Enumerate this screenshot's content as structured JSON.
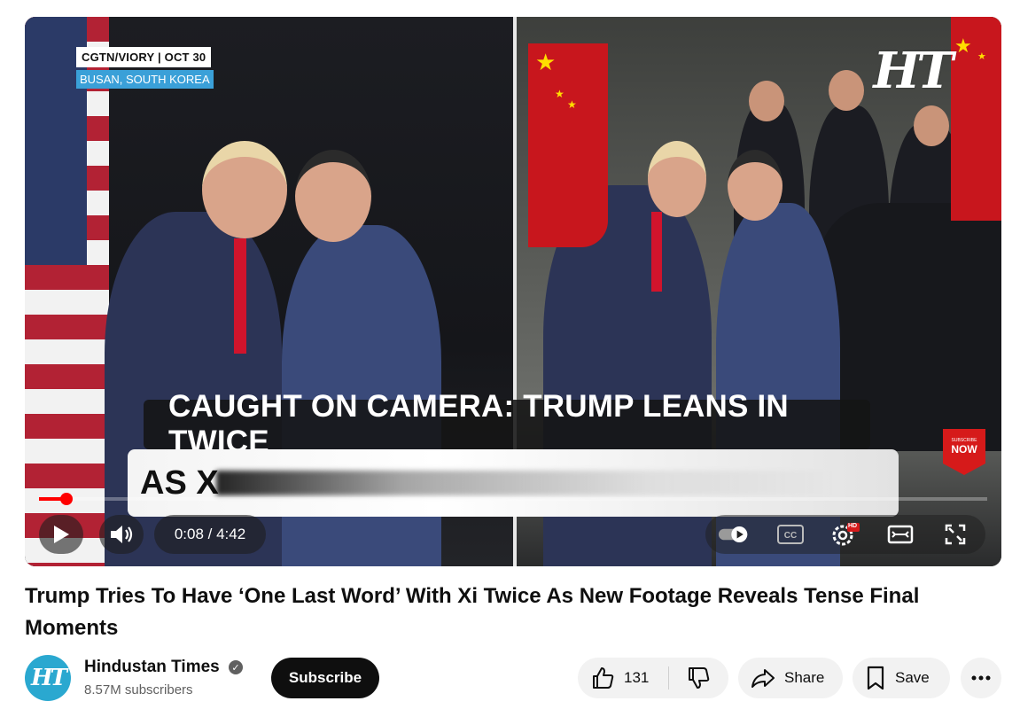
{
  "video": {
    "overlay_source": "CGTN/VIORY | OCT 30",
    "overlay_location": "BUSAN, SOUTH KOREA",
    "watermark": "HT",
    "caption_line1": "CAUGHT ON CAMERA: TRUMP LEANS IN TWICE",
    "caption_line2": "AS X",
    "subscribe_badge_small": "SUBSCRIBE",
    "subscribe_badge_big": "NOW"
  },
  "player": {
    "progress_fraction": 0.029,
    "current_time": "0:08",
    "duration": "4:42",
    "time_display": "0:08 / 4:42",
    "hd_badge": "HD",
    "icons": [
      "play-icon",
      "volume-icon",
      "autoplay-toggle-icon",
      "captions-icon",
      "settings-icon",
      "theater-mode-icon",
      "fullscreen-icon"
    ]
  },
  "title": "Trump Tries To Have ‘One Last Word’ With Xi Twice As New Footage Reveals Tense Final Moments",
  "channel": {
    "avatar_text": "HT",
    "name": "Hindustan Times",
    "subscribers": "8.57M subscribers",
    "subscribe_label": "Subscribe"
  },
  "actions": {
    "like_count": "131",
    "share_label": "Share",
    "save_label": "Save"
  },
  "colors": {
    "accent_red": "#ff0000",
    "subscribe_bg": "#0f0f0f",
    "pill_bg": "#f2f2f2",
    "location_badge": "#3aa0d8",
    "channel_avatar": "#2aa8d0"
  }
}
